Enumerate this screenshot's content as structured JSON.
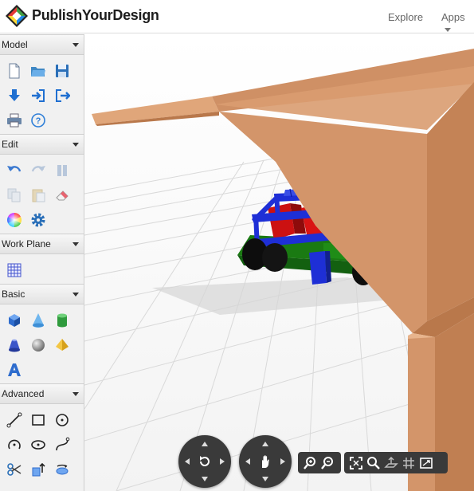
{
  "header": {
    "brand": "PublishYourDesign",
    "nav": {
      "explore": "Explore",
      "apps": "Apps"
    },
    "logo_icon": "diamond-logo-icon"
  },
  "sidebar": {
    "sections": [
      {
        "id": "model",
        "title": "Model",
        "icons": [
          "new-file-icon",
          "open-folder-icon",
          "save-icon",
          "import-icon",
          "import-arrow-icon",
          "export-icon",
          "print-icon",
          "help-icon"
        ]
      },
      {
        "id": "edit",
        "title": "Edit",
        "icons": [
          "undo-icon",
          "redo-icon",
          "pause-icon",
          "copy-icon",
          "paste-icon",
          "eraser-icon",
          "color-wheel-icon",
          "settings-gear-icon"
        ]
      },
      {
        "id": "workplane",
        "title": "Work Plane",
        "icons": [
          "grid-plane-icon"
        ]
      },
      {
        "id": "basic",
        "title": "Basic",
        "icons": [
          "cube-icon",
          "cone-icon",
          "cylinder-icon",
          "frustum-icon",
          "sphere-icon",
          "pyramid-icon",
          "text-3d-icon"
        ]
      },
      {
        "id": "advanced",
        "title": "Advanced",
        "icons": [
          "line-tool-icon",
          "rectangle-tool-icon",
          "circle-tool-icon",
          "arc-tool-icon",
          "ellipse-tool-icon",
          "curve-tool-icon",
          "scissors-icon",
          "extrude-icon",
          "revolve-icon"
        ]
      }
    ]
  },
  "colors": {
    "car_body": "#1a7a12",
    "car_frame": "#1e2fd6",
    "car_seats": "#cc1111",
    "wheels": "#0d0d0d",
    "wall": "#d3956a",
    "controls": "#3a3a3a"
  },
  "controls": {
    "orbit_icon": "orbit-icon",
    "pan_icon": "pan-hand-icon",
    "zoom_tools": [
      "zoom-in-icon",
      "zoom-out-icon"
    ],
    "view_tools": [
      "fit-view-icon",
      "search-icon",
      "snap-plane-icon",
      "grid-toggle-icon",
      "fullscreen-icon"
    ]
  }
}
